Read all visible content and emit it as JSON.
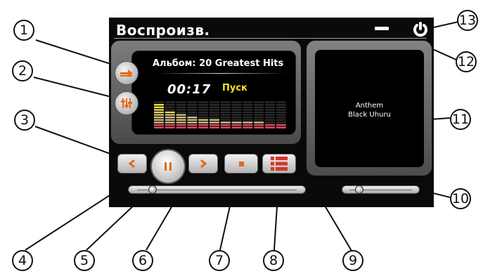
{
  "screen": {
    "title": "Воспроизв.",
    "minimize_icon": "minimize-icon",
    "power_icon": "power-icon"
  },
  "player": {
    "album_line": "Альбом: 20 Greatest Hits",
    "time": "00:17",
    "state": "Пуск",
    "progress_fraction": 0.1,
    "volume_fraction": 0.17,
    "equalizer_colors": {
      "top": "#e5e04a",
      "middle": "#d2c08a",
      "bottom": "#e0506a"
    }
  },
  "album_panel": {
    "track_title": "Anthem",
    "track_artist": "Black Uhuru"
  },
  "controls": {
    "repeat_icon": "repeat-arrow-icon",
    "equalizer_icon": "equalizer-icon",
    "prev_icon": "chevron-left-icon",
    "pause_icon": "pause-icon",
    "next_icon": "chevron-right-icon",
    "stop_icon": "stop-icon",
    "playlist_icon": "playlist-icon",
    "accent_color": "#e46a1a"
  },
  "callouts": [
    "1",
    "2",
    "3",
    "4",
    "5",
    "6",
    "7",
    "8",
    "9",
    "10",
    "11",
    "12",
    "13"
  ]
}
